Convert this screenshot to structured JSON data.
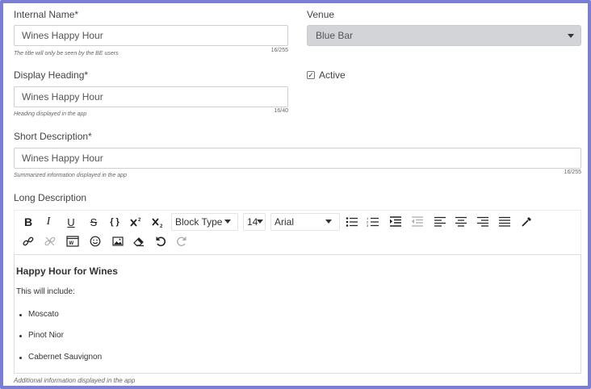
{
  "internal_name": {
    "label": "Internal Name*",
    "value": "Wines Happy Hour",
    "hint": "The title will only be seen by the BE users",
    "counter": "16/255"
  },
  "venue": {
    "label": "Venue",
    "value": "Blue Bar"
  },
  "display_heading": {
    "label": "Display Heading*",
    "value": "Wines Happy Hour",
    "hint": "Heading displayed in the app",
    "counter": "16/40"
  },
  "active": {
    "label": "Active",
    "checked": true,
    "checkmark": "✓"
  },
  "short_description": {
    "label": "Short Description*",
    "value": "Wines Happy Hour",
    "hint": "Summarized information displayed in the app",
    "counter": "16/255"
  },
  "long_description": {
    "label": "Long Description",
    "hint": "Additional information displayed in the app",
    "toolbar": {
      "bold": "B",
      "italic": "I",
      "underline": "U",
      "strikethrough": "S",
      "code": "{ }",
      "block_type": "Block Type",
      "font_size": "14",
      "font_family": "Arial"
    },
    "content": {
      "heading": "Happy Hour for Wines",
      "paragraph": "This will include:",
      "items": [
        "Moscato",
        "Pinot Nior",
        "Cabernet Sauvignon"
      ]
    }
  },
  "colors": {
    "frame": "#7b7fd4",
    "select_bg": "#d2d4d8"
  }
}
